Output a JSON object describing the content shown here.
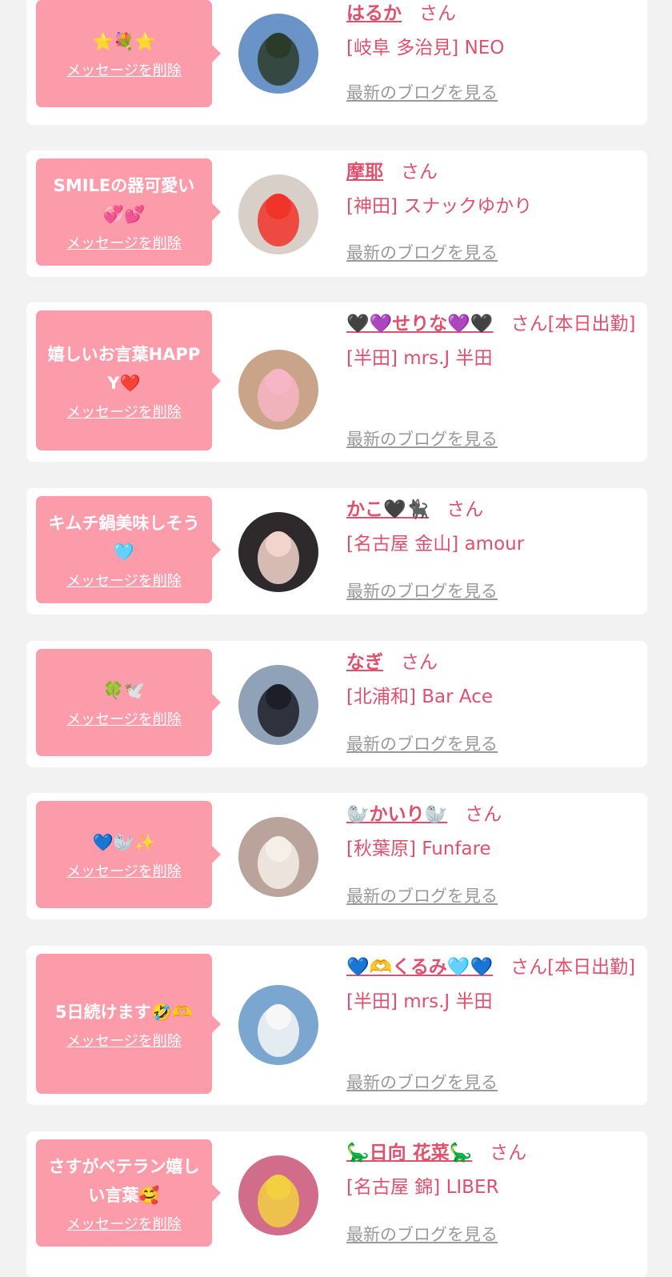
{
  "cards": [
    {
      "bubble": "⭐💐⭐",
      "delete": "メッセージを削除",
      "name": "はるか",
      "san": "さん",
      "shop": "[岐阜 多治見] NEO",
      "blog": "最新のブログを見る"
    },
    {
      "bubble": "SMILEの器可愛い💞💕",
      "delete": "メッセージを削除",
      "name": "摩耶",
      "san": "さん",
      "shop": "[神田] スナックゆかり",
      "blog": "最新のブログを見る"
    },
    {
      "bubble": "嬉しいお言葉HAPPY❤️",
      "delete": "メッセージを削除",
      "name": "🖤💜せりな💜🖤",
      "san": "さん[本日出勤]",
      "shop": "[半田] mrs.J 半田",
      "blog": "最新のブログを見る"
    },
    {
      "bubble": "キムチ鍋美味しそう🩵",
      "delete": "メッセージを削除",
      "name": "かこ🖤🐈‍⬛",
      "san": "さん",
      "shop": "[名古屋 金山] amour",
      "blog": "最新のブログを見る"
    },
    {
      "bubble": "🍀🕊️",
      "delete": "メッセージを削除",
      "name": "なぎ",
      "san": "さん",
      "shop": "[北浦和] Bar Ace",
      "blog": "最新のブログを見る"
    },
    {
      "bubble": "💙🦭✨",
      "delete": "メッセージを削除",
      "name": "🦭かいり🦭",
      "san": "さん",
      "shop": "[秋葉原] Funfare",
      "blog": "最新のブログを見る"
    },
    {
      "bubble": "5日続けます🤣🫶",
      "delete": "メッセージを削除",
      "name": "💙🫶くるみ🩵💙",
      "san": "さん[本日出勤]",
      "shop": "[半田] mrs.J 半田",
      "blog": "最新のブログを見る"
    },
    {
      "bubble": "さすがベテラン嬉しい言葉🥰",
      "delete": "メッセージを削除",
      "name": "🦕日向 花菜🦕",
      "san": "さん",
      "shop": "[名古屋 錦] LIBER",
      "blog": "最新のブログを見る"
    }
  ],
  "avatars": [
    {
      "icon": "photo-sky-tree",
      "bg": "#6a93c7",
      "fg": "#2b3b2a"
    },
    {
      "icon": "photo-heart-face",
      "bg": "#d9cfc9",
      "fg": "#f0342a"
    },
    {
      "icon": "photo-heart-face",
      "bg": "#c9a488",
      "fg": "#f7b6c6"
    },
    {
      "icon": "photo-portrait",
      "bg": "#2e2a2c",
      "fg": "#f3d4cc"
    },
    {
      "icon": "photo-sunset-silhouette",
      "bg": "#8fa2b8",
      "fg": "#1c1f27"
    },
    {
      "icon": "photo-maid",
      "bg": "#b9a39a",
      "fg": "#f4efe9"
    },
    {
      "icon": "photo-cap",
      "bg": "#7aa6cf",
      "fg": "#f7f7f7"
    },
    {
      "icon": "photo-ball-pit",
      "bg": "#d16d8a",
      "fg": "#f2d040"
    }
  ]
}
